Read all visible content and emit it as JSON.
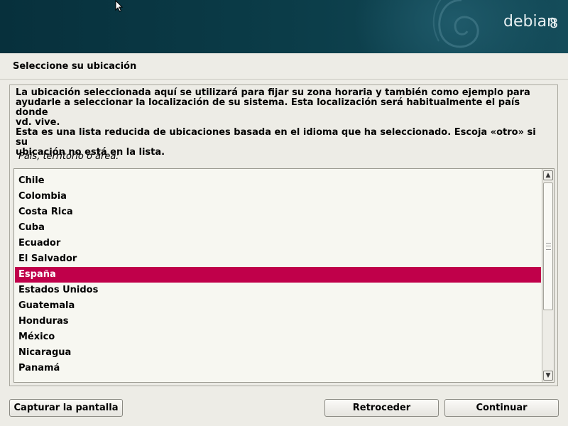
{
  "banner": {
    "brand_name": "debian",
    "brand_version": "8",
    "colors": {
      "background": "#0b3c48",
      "text": "#e6eef0"
    }
  },
  "page_title": "Seleccione su ubicación",
  "description": {
    "paragraph1": "La ubicación seleccionada aquí se utilizará para fijar su zona horaria y también como ejemplo para\nayudarle a seleccionar la localización de su sistema. Esta localización será habitualmente el país donde\nvd. vive.",
    "paragraph2": "Esta es una lista reducida de ubicaciones basada en el idioma que ha seleccionado. Escoja «otro» si su\nubicación no está en la lista."
  },
  "list": {
    "label": "País, territorio o área:",
    "items": [
      "Chile",
      "Colombia",
      "Costa Rica",
      "Cuba",
      "Ecuador",
      "El Salvador",
      "España",
      "Estados Unidos",
      "Guatemala",
      "Honduras",
      "México",
      "Nicaragua",
      "Panamá"
    ],
    "selected": "España",
    "selection_color": "#c0004a"
  },
  "buttons": {
    "screenshot": "Capturar la pantalla",
    "back": "Retroceder",
    "continue": "Continuar"
  },
  "scrollbar": {
    "up_icon": "arrow-up-icon",
    "down_icon": "arrow-down-icon"
  }
}
